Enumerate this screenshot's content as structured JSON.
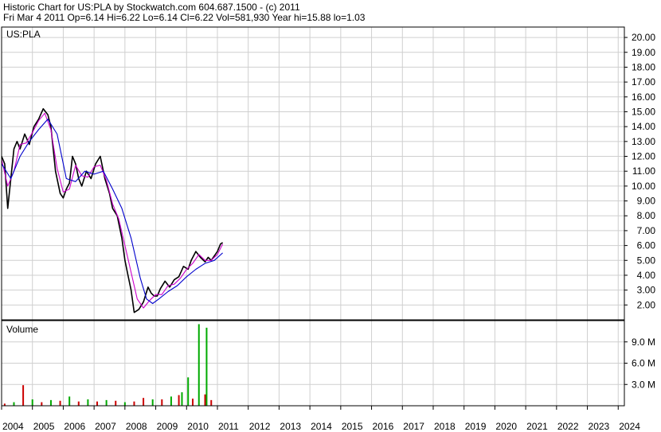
{
  "header": {
    "line1": "Historic Chart for US:PLA by Stockwatch.com 604.687.1500 - (c) 2011",
    "line2": "Fri Mar  4 2011  Op=6.14  Hi=6.22  Lo=6.14  Cl=6.22  Vol=581,930  Year hi=15.88  lo=1.03"
  },
  "chart_data": [
    {
      "type": "line",
      "panel_label": "US:PLA",
      "x_ticks": [
        "2004",
        "2005",
        "2006",
        "2007",
        "2008",
        "2009",
        "2010",
        "2011",
        "2012",
        "2013",
        "2014",
        "2015",
        "2016",
        "2017",
        "2018",
        "2019",
        "2020",
        "2021",
        "2022",
        "2023",
        "2024"
      ],
      "y_ticks": [
        "2.00",
        "3.00",
        "4.00",
        "5.00",
        "6.00",
        "7.00",
        "8.00",
        "9.00",
        "10.00",
        "11.00",
        "12.00",
        "13.00",
        "14.00",
        "15.00",
        "16.00",
        "17.00",
        "18.00",
        "19.00",
        "20.00"
      ],
      "ylim": [
        1.0,
        20.7
      ],
      "xlim": [
        2004.0,
        2024.2
      ],
      "grid": true,
      "series": [
        {
          "color": "#000000",
          "x": [
            2004.0,
            2004.1,
            2004.2,
            2004.3,
            2004.4,
            2004.5,
            2004.6,
            2004.75,
            2004.9,
            2005.05,
            2005.2,
            2005.35,
            2005.5,
            2005.6,
            2005.75,
            2005.9,
            2006.0,
            2006.1,
            2006.2,
            2006.3,
            2006.4,
            2006.5,
            2006.6,
            2006.75,
            2006.9,
            2007.05,
            2007.2,
            2007.35,
            2007.5,
            2007.6,
            2007.75,
            2007.9,
            2008.0,
            2008.1,
            2008.2,
            2008.3,
            2008.45,
            2008.6,
            2008.75,
            2008.85,
            2008.95,
            2009.05,
            2009.15,
            2009.3,
            2009.45,
            2009.6,
            2009.75,
            2009.9,
            2010.05,
            2010.15,
            2010.3,
            2010.45,
            2010.6,
            2010.7,
            2010.8,
            2010.9,
            2011.0,
            2011.1,
            2011.17
          ],
          "y": [
            12.0,
            11.5,
            8.5,
            10.5,
            12.5,
            13.0,
            12.5,
            13.5,
            12.8,
            14.0,
            14.5,
            15.2,
            14.8,
            14.0,
            11.0,
            9.5,
            9.2,
            9.8,
            10.2,
            12.0,
            11.5,
            10.5,
            10.0,
            11.0,
            10.5,
            11.5,
            12.0,
            10.5,
            9.5,
            8.5,
            8.0,
            6.5,
            5.0,
            4.0,
            3.0,
            1.5,
            1.7,
            2.2,
            3.2,
            2.8,
            2.6,
            2.6,
            3.1,
            3.6,
            3.2,
            3.7,
            3.9,
            4.6,
            4.4,
            5.0,
            5.6,
            5.2,
            4.9,
            5.2,
            5.0,
            5.3,
            5.6,
            6.1,
            6.2
          ]
        },
        {
          "color": "#cc00cc",
          "x": [
            2004.0,
            2004.2,
            2004.4,
            2004.6,
            2004.8,
            2005.0,
            2005.2,
            2005.4,
            2005.6,
            2005.8,
            2006.0,
            2006.2,
            2006.4,
            2006.6,
            2006.8,
            2007.0,
            2007.2,
            2007.4,
            2007.6,
            2007.8,
            2008.0,
            2008.2,
            2008.4,
            2008.6,
            2008.8,
            2009.0,
            2009.2,
            2009.4,
            2009.6,
            2009.8,
            2010.0,
            2010.2,
            2010.4,
            2010.6,
            2010.8,
            2011.0,
            2011.17
          ],
          "y": [
            11.8,
            10.0,
            11.0,
            12.8,
            12.9,
            13.6,
            14.4,
            14.9,
            13.8,
            11.2,
            9.6,
            9.8,
            11.4,
            10.7,
            10.6,
            11.3,
            11.4,
            10.4,
            8.8,
            7.8,
            6.0,
            4.2,
            2.4,
            1.8,
            2.3,
            2.7,
            2.7,
            3.3,
            3.4,
            3.8,
            4.4,
            4.8,
            5.4,
            5.0,
            5.0,
            5.4,
            6.1
          ]
        },
        {
          "color": "#0000cc",
          "x": [
            2004.0,
            2004.3,
            2004.6,
            2004.9,
            2005.2,
            2005.5,
            2005.8,
            2006.1,
            2006.4,
            2006.7,
            2007.0,
            2007.3,
            2007.6,
            2007.9,
            2008.2,
            2008.5,
            2008.7,
            2008.9,
            2009.1,
            2009.4,
            2009.7,
            2010.0,
            2010.3,
            2010.6,
            2010.9,
            2011.17
          ],
          "y": [
            11.5,
            10.5,
            12.0,
            13.0,
            13.8,
            14.5,
            13.5,
            10.5,
            10.3,
            11.0,
            10.8,
            11.0,
            9.8,
            8.5,
            6.5,
            3.8,
            2.4,
            2.1,
            2.4,
            2.9,
            3.3,
            3.9,
            4.4,
            4.8,
            5.0,
            5.5
          ]
        }
      ]
    },
    {
      "type": "bar",
      "panel_label": "Volume",
      "y_ticks": [
        "3.0 M",
        "6.0 M",
        "9.0 M"
      ],
      "ylim": [
        0,
        12000000
      ],
      "grid": true,
      "x": [
        2004.1,
        2004.4,
        2004.7,
        2005.0,
        2005.3,
        2005.6,
        2005.9,
        2006.2,
        2006.5,
        2006.8,
        2007.1,
        2007.4,
        2007.7,
        2008.0,
        2008.3,
        2008.6,
        2008.9,
        2009.2,
        2009.5,
        2009.75,
        2009.85,
        2010.05,
        2010.2,
        2010.4,
        2010.6,
        2010.65,
        2010.8
      ],
      "values": [
        300000,
        500000,
        2900000,
        900000,
        500000,
        800000,
        700000,
        1300000,
        600000,
        900000,
        600000,
        800000,
        700000,
        500000,
        600000,
        1100000,
        900000,
        900000,
        1300000,
        1500000,
        1900000,
        4000000,
        1000000,
        11500000,
        1600000,
        11000000,
        800000
      ],
      "colors": [
        "#cc0000",
        "#00aa00",
        "#cc0000",
        "#00aa00",
        "#cc0000",
        "#00aa00",
        "#cc0000",
        "#00aa00",
        "#cc0000",
        "#00aa00",
        "#cc0000",
        "#00aa00",
        "#cc0000",
        "#00aa00",
        "#cc0000",
        "#cc0000",
        "#00aa00",
        "#cc0000",
        "#00aa00",
        "#cc0000",
        "#00aa00",
        "#00aa00",
        "#cc0000",
        "#00aa00",
        "#cc0000",
        "#00aa00",
        "#cc0000"
      ]
    }
  ]
}
